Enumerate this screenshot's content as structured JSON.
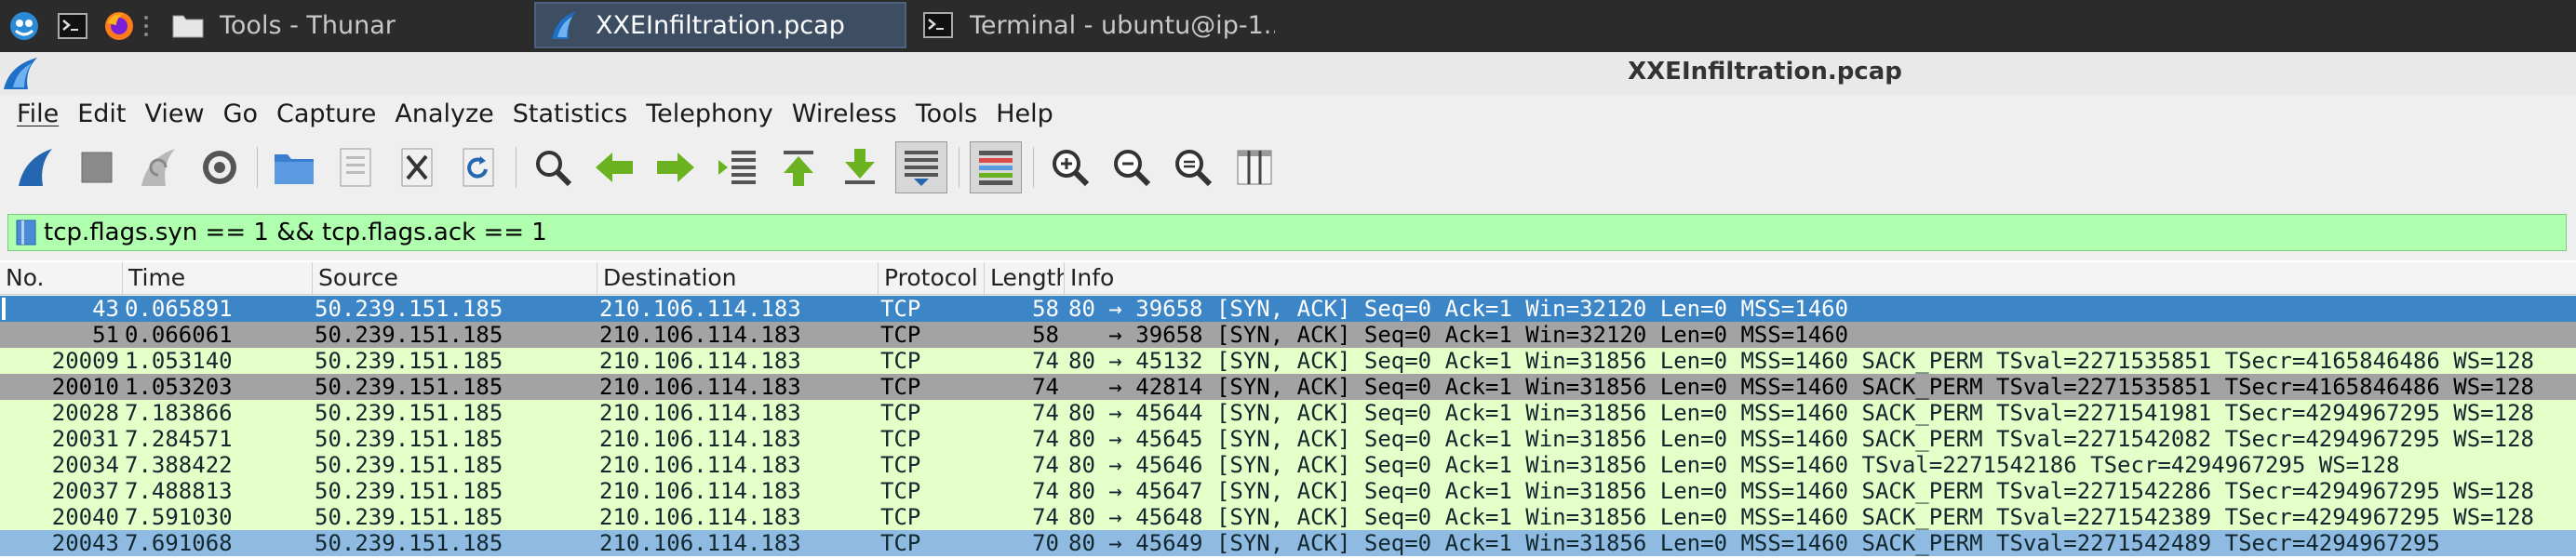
{
  "taskbar": {
    "tasks": [
      {
        "label": "Tools - Thunar",
        "icon": "folder-icon"
      },
      {
        "label": "XXEInfiltration.pcap",
        "icon": "wireshark-fin-icon"
      },
      {
        "label": "Terminal - ubuntu@ip-1...",
        "icon": "terminal-icon"
      }
    ]
  },
  "window": {
    "title": "XXEInfiltration.pcap"
  },
  "menu": [
    "File",
    "Edit",
    "View",
    "Go",
    "Capture",
    "Analyze",
    "Statistics",
    "Telephony",
    "Wireless",
    "Tools",
    "Help"
  ],
  "filter": {
    "value": "tcp.flags.syn == 1 && tcp.flags.ack == 1"
  },
  "columns": [
    "No.",
    "Time",
    "Source",
    "Destination",
    "Protocol",
    "Length",
    "Info"
  ],
  "rows": [
    {
      "no": "43",
      "time": "0.065891",
      "src": "50.239.151.185",
      "dst": "210.106.114.183",
      "proto": "TCP",
      "len": "58",
      "info": "80 → 39658 [SYN, ACK] Seq=0 Ack=1 Win=32120 Len=0 MSS=1460",
      "style": "sel"
    },
    {
      "no": "51",
      "time": "0.066061",
      "src": "50.239.151.185",
      "dst": "210.106.114.183",
      "proto": "TCP",
      "len": "58",
      "info": "   → 39658 [SYN, ACK] Seq=0 Ack=1 Win=32120 Len=0 MSS=1460",
      "style": "gray"
    },
    {
      "no": "20009",
      "time": "1.053140",
      "src": "50.239.151.185",
      "dst": "210.106.114.183",
      "proto": "TCP",
      "len": "74",
      "info": "80 → 45132 [SYN, ACK] Seq=0 Ack=1 Win=31856 Len=0 MSS=1460 SACK_PERM TSval=2271535851 TSecr=4165846486 WS=128",
      "style": "green"
    },
    {
      "no": "20010",
      "time": "1.053203",
      "src": "50.239.151.185",
      "dst": "210.106.114.183",
      "proto": "TCP",
      "len": "74",
      "info": "   → 42814 [SYN, ACK] Seq=0 Ack=1 Win=31856 Len=0 MSS=1460 SACK_PERM TSval=2271535851 TSecr=4165846486 WS=128",
      "style": "gray"
    },
    {
      "no": "20028",
      "time": "7.183866",
      "src": "50.239.151.185",
      "dst": "210.106.114.183",
      "proto": "TCP",
      "len": "74",
      "info": "80 → 45644 [SYN, ACK] Seq=0 Ack=1 Win=31856 Len=0 MSS=1460 SACK_PERM TSval=2271541981 TSecr=4294967295 WS=128",
      "style": "green"
    },
    {
      "no": "20031",
      "time": "7.284571",
      "src": "50.239.151.185",
      "dst": "210.106.114.183",
      "proto": "TCP",
      "len": "74",
      "info": "80 → 45645 [SYN, ACK] Seq=0 Ack=1 Win=31856 Len=0 MSS=1460 SACK_PERM TSval=2271542082 TSecr=4294967295 WS=128",
      "style": "green"
    },
    {
      "no": "20034",
      "time": "7.388422",
      "src": "50.239.151.185",
      "dst": "210.106.114.183",
      "proto": "TCP",
      "len": "74",
      "info": "80 → 45646 [SYN, ACK] Seq=0 Ack=1 Win=31856 Len=0 MSS=1460 TSval=2271542186 TSecr=4294967295 WS=128",
      "style": "green"
    },
    {
      "no": "20037",
      "time": "7.488813",
      "src": "50.239.151.185",
      "dst": "210.106.114.183",
      "proto": "TCP",
      "len": "74",
      "info": "80 → 45647 [SYN, ACK] Seq=0 Ack=1 Win=31856 Len=0 MSS=1460 SACK_PERM TSval=2271542286 TSecr=4294967295 WS=128",
      "style": "green"
    },
    {
      "no": "20040",
      "time": "7.591030",
      "src": "50.239.151.185",
      "dst": "210.106.114.183",
      "proto": "TCP",
      "len": "74",
      "info": "80 → 45648 [SYN, ACK] Seq=0 Ack=1 Win=31856 Len=0 MSS=1460 SACK_PERM TSval=2271542389 TSecr=4294967295 WS=128",
      "style": "green"
    },
    {
      "no": "20043",
      "time": "7.691068",
      "src": "50.239.151.185",
      "dst": "210.106.114.183",
      "proto": "TCP",
      "len": "70",
      "info": "80 → 45649 [SYN, ACK] Seq=0 Ack=1 Win=31856 Len=0 MSS=1460 SACK_PERM TSval=2271542489 TSecr=4294967295",
      "style": "blue"
    }
  ],
  "colors": {
    "selected_row": "#3c86c8",
    "filter_valid": "#afffaf",
    "tcp_row": "#e4ffc7",
    "duplicate_row": "#a3a3a3"
  }
}
